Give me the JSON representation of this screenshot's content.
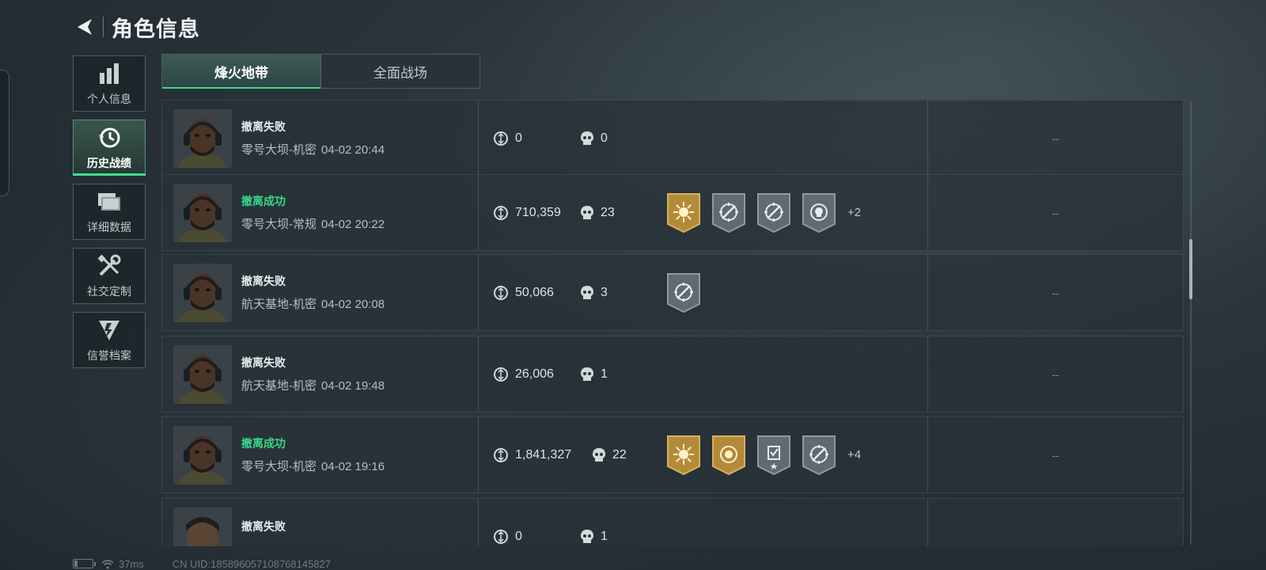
{
  "header": {
    "title": "角色信息"
  },
  "sidenav": [
    {
      "label": "个人信息",
      "icon": "bar-chart-icon",
      "active": false
    },
    {
      "label": "历史战绩",
      "icon": "history-clock-icon",
      "active": true
    },
    {
      "label": "详细数据",
      "icon": "folder-icon",
      "active": false
    },
    {
      "label": "社交定制",
      "icon": "tools-icon",
      "active": false
    },
    {
      "label": "信誉档案",
      "icon": "shield-emblem-icon",
      "active": false
    }
  ],
  "tabs": [
    {
      "label": "烽火地带",
      "active": true
    },
    {
      "label": "全面战场",
      "active": false
    }
  ],
  "records": [
    {
      "result": "撤离失败",
      "success": false,
      "map": "零号大坝-机密",
      "time": "04-02 20:44",
      "value": "0",
      "kills": "0",
      "badges": [],
      "more": "",
      "extra": "--"
    },
    {
      "result": "撤离成功",
      "success": true,
      "map": "零号大坝-常规",
      "time": "04-02 20:22",
      "value": "710,359",
      "kills": "23",
      "badges": [
        "gold-sun-badge",
        "silver-crosshair-badge",
        "silver-crosshair-badge",
        "silver-skull-target-badge"
      ],
      "more": "+2",
      "extra": "--"
    },
    {
      "result": "撤离失败",
      "success": false,
      "map": "航天基地-机密",
      "time": "04-02 20:08",
      "value": "50,066",
      "kills": "3",
      "badges": [
        "silver-crosshair-badge"
      ],
      "more": "",
      "extra": "--"
    },
    {
      "result": "撤离失败",
      "success": false,
      "map": "航天基地-机密",
      "time": "04-02 19:48",
      "value": "26,006",
      "kills": "1",
      "badges": [],
      "more": "",
      "extra": "--"
    },
    {
      "result": "撤离成功",
      "success": true,
      "map": "零号大坝-机密",
      "time": "04-02 19:16",
      "value": "1,841,327",
      "kills": "22",
      "badges": [
        "gold-sun-badge",
        "gold-coin-badge",
        "silver-checklist-badge",
        "silver-crosshair-badge"
      ],
      "more": "+4",
      "extra": "--"
    },
    {
      "result": "撤离失败",
      "success": false,
      "map": "",
      "time": "",
      "value": "0",
      "kills": "1",
      "badges": [],
      "more": "",
      "extra": ""
    }
  ],
  "footer": {
    "ping": "37ms",
    "uid": "CN UID:185896057108768145827"
  },
  "colors": {
    "success": "#39d98a",
    "accent": "#43d48e",
    "gold": "#b38a3a",
    "silver": "#6f7b80"
  }
}
